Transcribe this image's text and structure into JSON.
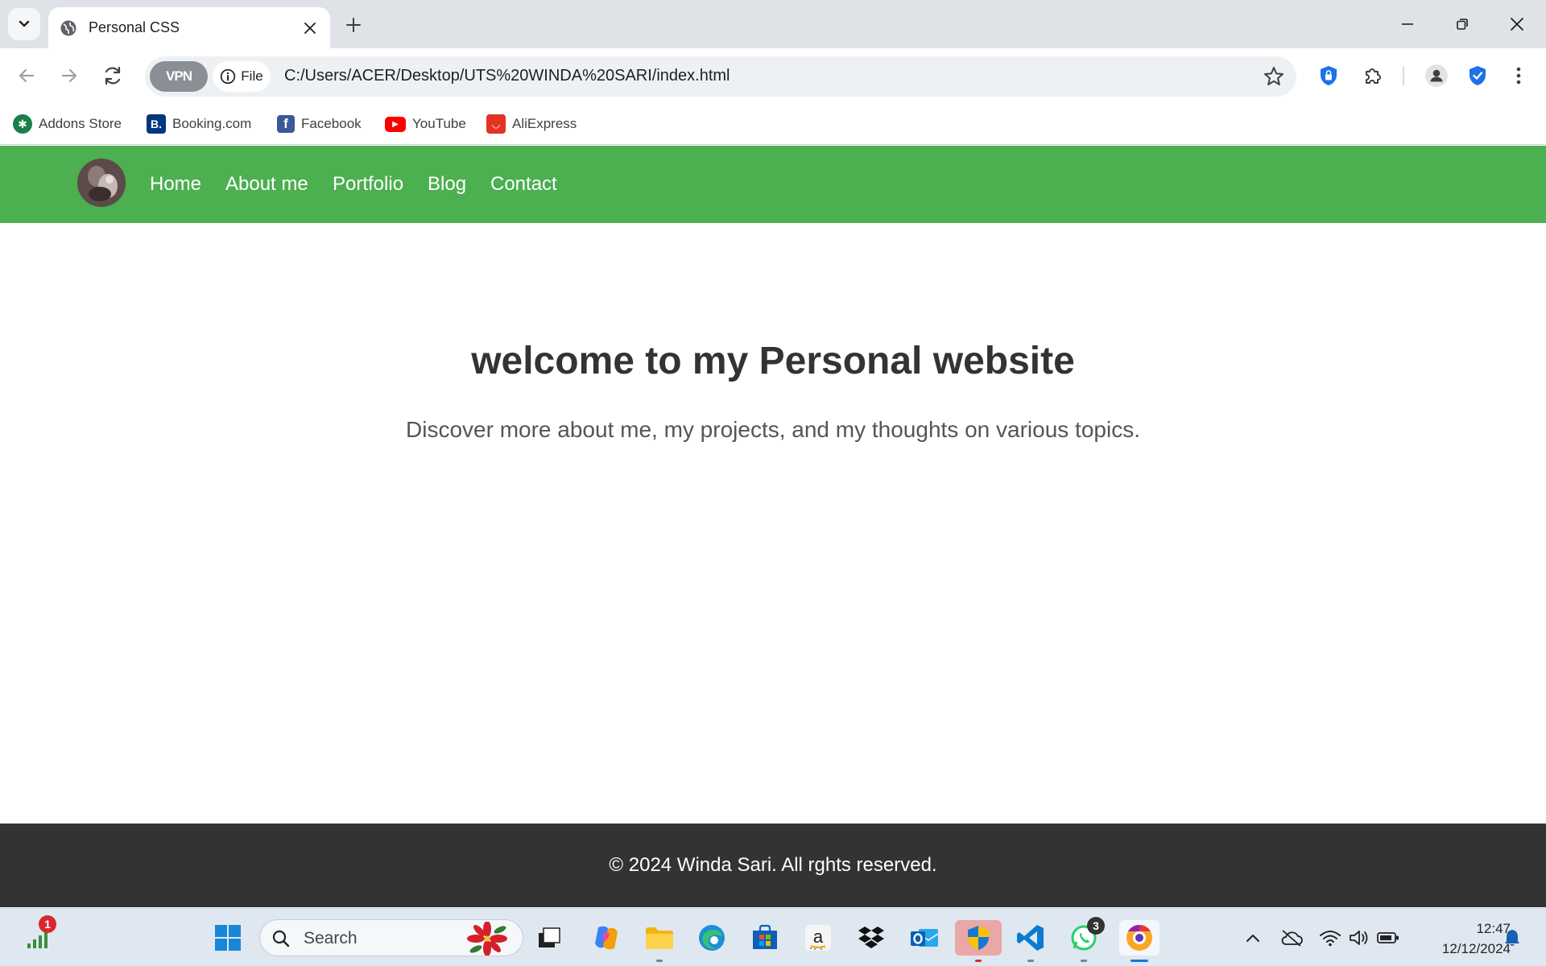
{
  "browser": {
    "tab_title": "Personal CSS",
    "vpn_label": "VPN",
    "file_chip_label": "File",
    "url": "C:/Users/ACER/Desktop/UTS%20WINDA%20SARI/index.html"
  },
  "bookmarks": [
    {
      "label": "Addons Store",
      "icon": "addons-store-icon",
      "color": "#1a7f4b"
    },
    {
      "label": "Booking.com",
      "icon": "booking-icon",
      "color": "#003580"
    },
    {
      "label": "Facebook",
      "icon": "facebook-icon",
      "color": "#3b5998"
    },
    {
      "label": "YouTube",
      "icon": "youtube-icon",
      "color": "#ff0000"
    },
    {
      "label": "AliExpress",
      "icon": "aliexpress-icon",
      "color": "#e43225"
    }
  ],
  "site": {
    "accent_color": "#4caf50",
    "nav": [
      {
        "label": "Home"
      },
      {
        "label": "About me"
      },
      {
        "label": "Portfolio"
      },
      {
        "label": "Blog"
      },
      {
        "label": "Contact"
      }
    ],
    "hero_title": "welcome to my Personal website",
    "hero_subtitle": "Discover more about me, my projects, and my thoughts on various topics.",
    "footer_text": "© 2024 Winda Sari. All rghts reserved."
  },
  "taskbar": {
    "search_label": "Search",
    "network_badge": "1",
    "whatsapp_badge": "3",
    "time": "12:47",
    "date": "12/12/2024"
  }
}
